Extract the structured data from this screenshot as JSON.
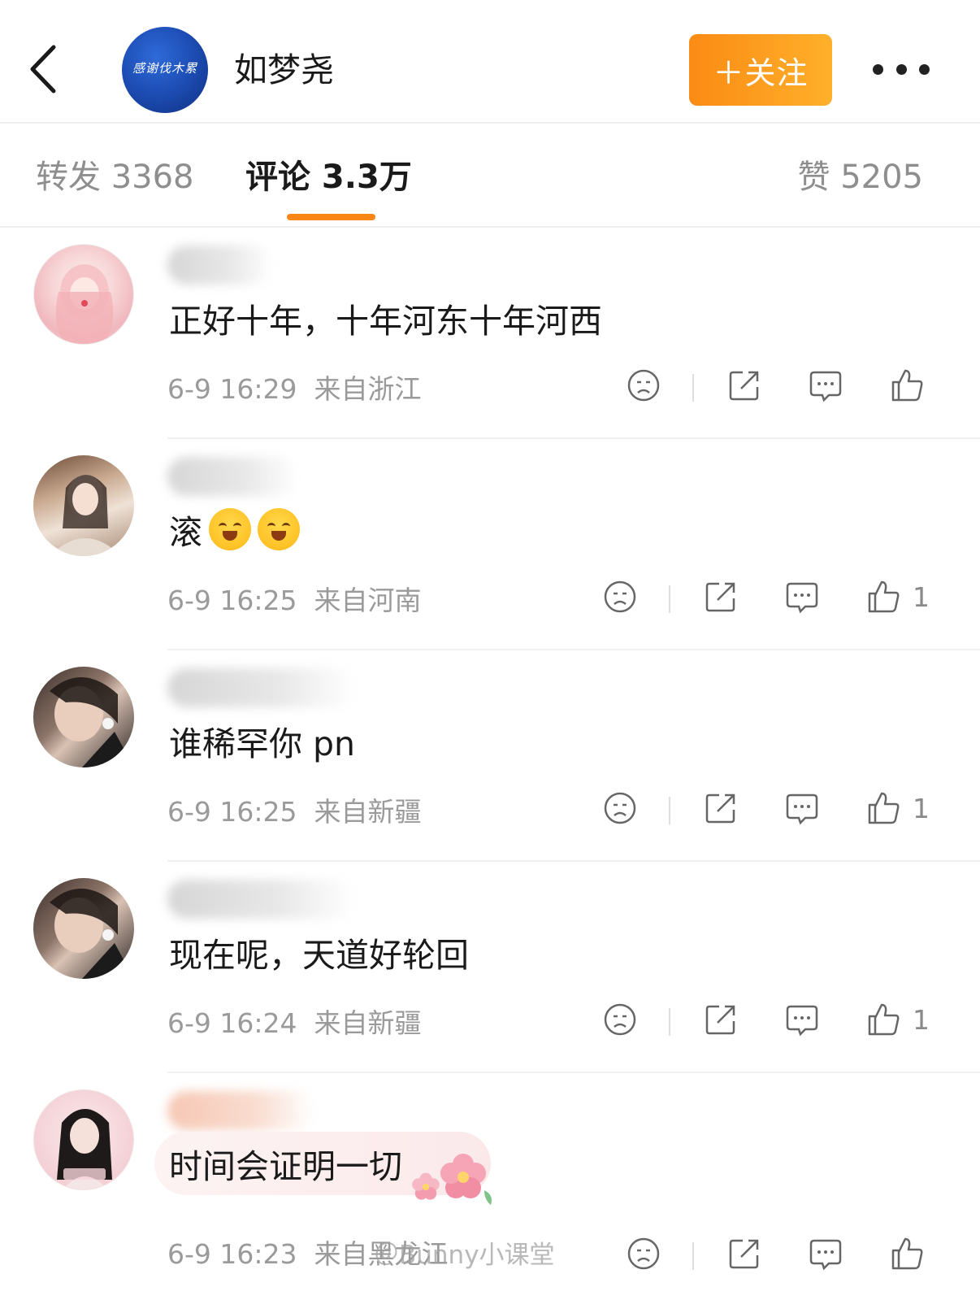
{
  "header": {
    "back_icon": "chevron-left-icon",
    "avatar_text": "感谢伐木累",
    "title": "如梦尧",
    "follow_label": "＋关注",
    "more_icon": "more-horizontal-icon",
    "accent_color": "#fb8b14"
  },
  "tabs": {
    "repost": "转发 3368",
    "comments": "评论 3.3万",
    "likes": "赞 5205"
  },
  "comments": [
    {
      "text": "正好十年，十年河东十年河西",
      "time": "6-9 16:29",
      "location": "来自浙江",
      "likes": ""
    },
    {
      "text": "滚",
      "emoji_count": 2,
      "emoji": "hug-face-emoji",
      "time": "6-9 16:25",
      "location": "来自河南",
      "likes": "1"
    },
    {
      "text": "谁稀罕你 pn",
      "time": "6-9 16:25",
      "location": "来自新疆",
      "likes": "1"
    },
    {
      "text": "现在呢，天道好轮回",
      "time": "6-9 16:24",
      "location": "来自新疆",
      "likes": "1"
    },
    {
      "text": "时间会证明一切",
      "time": "6-9 16:23",
      "location": "来自黑龙江",
      "likes": ""
    }
  ],
  "watermark": "＠Bunny小课堂"
}
